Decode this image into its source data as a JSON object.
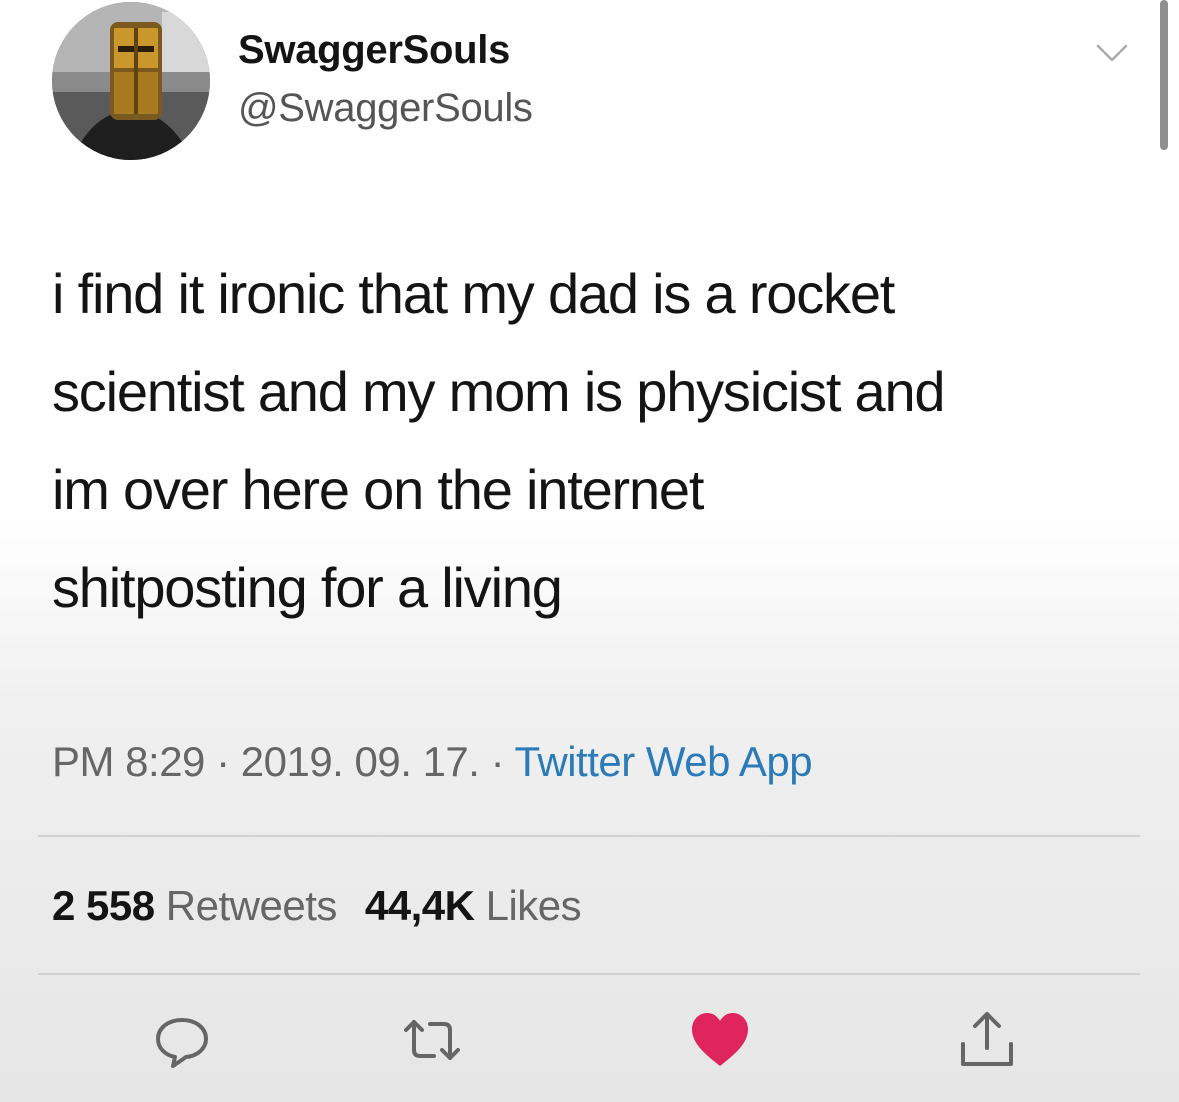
{
  "user": {
    "display_name": "SwaggerSouls",
    "handle": "@SwaggerSouls",
    "avatar_icon": "avatar-helmet"
  },
  "tweet": {
    "lines": [
      "i find it ironic that my dad is a rocket",
      "scientist and my mom is physicist and",
      "im over here on the internet",
      "shitposting for a living"
    ]
  },
  "meta": {
    "time": "PM 8:29",
    "sep1": " · ",
    "date": "2019. 09. 17.",
    "sep2": " · ",
    "source": "Twitter Web App"
  },
  "stats": {
    "retweets_count": "2 558",
    "retweets_label": "Retweets",
    "likes_count": "44,4K",
    "likes_label": "Likes"
  },
  "actions": {
    "reply_icon": "reply-icon",
    "retweet_icon": "retweet-icon",
    "like_icon": "heart-icon",
    "share_icon": "share-icon",
    "like_color": "#e0245e",
    "icon_color": "#666666"
  },
  "colors": {
    "link": "#2b7bb9",
    "text": "#141414",
    "secondary": "#666666"
  }
}
